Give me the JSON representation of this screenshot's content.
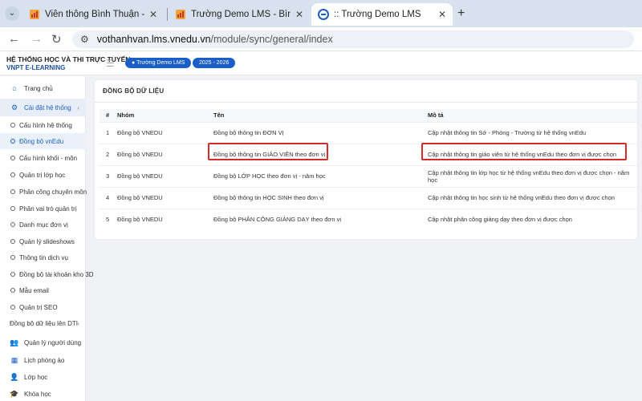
{
  "browser": {
    "tabs": [
      {
        "title": "Viễn thông Bình Thuận - Bình T",
        "close": "✕"
      },
      {
        "title": "Trường Demo LMS - Bình Thuậ",
        "close": "✕"
      },
      {
        "title": ":: Trường Demo LMS",
        "close": "✕"
      }
    ],
    "new_tab": "+",
    "url_domain": "vothanhvan.lms.vnedu.vn",
    "url_path": "/module/sync/general/index"
  },
  "header": {
    "brand_line1": "HỆ THỐNG HỌC VÀ THI TRỰC TUYẾN",
    "brand_line2": "VNPT E-LEARNING",
    "school": "Trường Demo LMS",
    "year": "2025 - 2026"
  },
  "sidebar": {
    "items": [
      {
        "label": "Trang chủ",
        "icon": "home-icon"
      },
      {
        "label": "Cài đặt hệ thống",
        "icon": "gear-icon"
      },
      {
        "label": "Cấu hình hệ thống"
      },
      {
        "label": "Đồng bộ vnEdu"
      },
      {
        "label": "Cấu hình khối - môn"
      },
      {
        "label": "Quản trị lớp học"
      },
      {
        "label": "Phân công chuyên môn"
      },
      {
        "label": "Phân vai trò quản trị"
      },
      {
        "label": "Danh mục đơn vị"
      },
      {
        "label": "Quản lý slideshows"
      },
      {
        "label": "Thông tin dịch vụ"
      },
      {
        "label": "Đồng bộ tài khoản kho 3D"
      },
      {
        "label": "Mẫu email"
      },
      {
        "label": "Quản trị SEO"
      },
      {
        "label": "Đồng bộ dữ liệu lên DTI"
      },
      {
        "label": "Quản lý người dùng",
        "icon": "users-icon"
      },
      {
        "label": "Lịch phòng ảo",
        "icon": "calendar-icon"
      },
      {
        "label": "Lớp học",
        "icon": "user-icon"
      },
      {
        "label": "Khóa học",
        "icon": "graduation-icon"
      }
    ]
  },
  "main": {
    "title": "ĐỒNG BỘ DỮ LIỆU",
    "columns": [
      "#",
      "Nhóm",
      "Tên",
      "Mô tả"
    ],
    "rows": [
      {
        "no": "1",
        "group": "Đồng bộ VNEDU",
        "name": "Đồng bộ thông tin ĐƠN VỊ",
        "desc": "Cập nhật thông tin Sở - Phòng - Trường từ hệ thống vnEdu"
      },
      {
        "no": "2",
        "group": "Đồng bộ VNEDU",
        "name": "Đồng bộ thông tin GIÁO VIÊN theo đơn vị",
        "desc": "Cập nhật thông tin giáo viên từ hệ thống vnEdu theo đơn vị được chọn"
      },
      {
        "no": "3",
        "group": "Đồng bộ VNEDU",
        "name": "Đồng bộ LỚP HỌC theo đơn vị - năm học",
        "desc": "Cập nhật thông tin lớp học từ hệ thống vnEdu theo đơn vị được chọn - năm học"
      },
      {
        "no": "4",
        "group": "Đồng bộ VNEDU",
        "name": "Đồng bộ thông tin HỌC SINH theo đơn vị",
        "desc": "Cập nhật thông tin học sinh từ hệ thống vnEdu theo đơn vị được chọn"
      },
      {
        "no": "5",
        "group": "Đồng bộ VNEDU",
        "name": "Đồng bộ PHÂN CÔNG GIẢNG DẠY theo đơn vị",
        "desc": "Cập nhật phân công giảng dạy theo đơn vị được chọn"
      }
    ]
  },
  "colors": {
    "accent": "#1b5ec7",
    "highlight": "#d32a2a"
  }
}
